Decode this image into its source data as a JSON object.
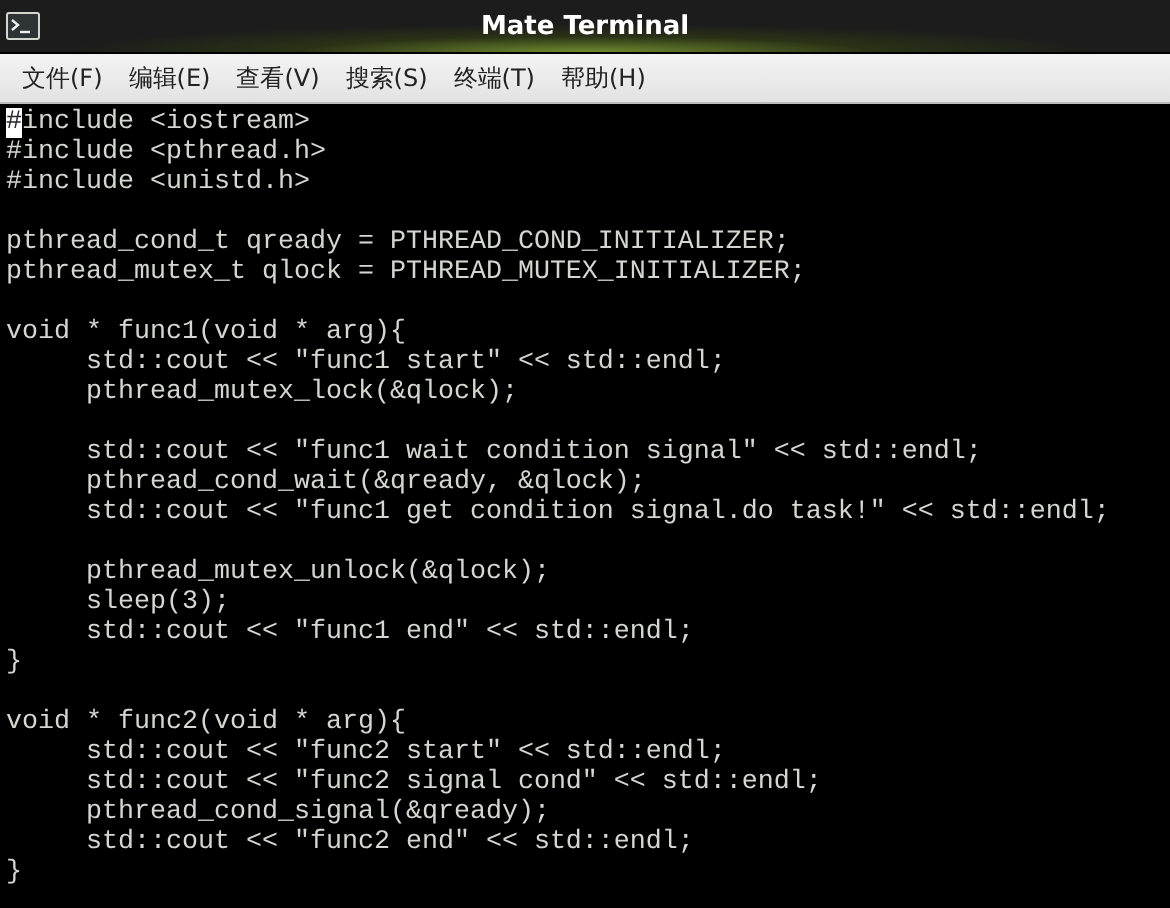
{
  "window": {
    "title": "Mate Terminal"
  },
  "menu": [
    {
      "label": "文件(F)"
    },
    {
      "label": "编辑(E)"
    },
    {
      "label": "查看(V)"
    },
    {
      "label": "搜索(S)"
    },
    {
      "label": "终端(T)"
    },
    {
      "label": "帮助(H)"
    }
  ],
  "terminal": {
    "lines": [
      {
        "kind": "code",
        "text": "#include <iostream>",
        "cursor": true
      },
      {
        "kind": "code",
        "text": "#include <pthread.h>",
        "cursor": false
      },
      {
        "kind": "code",
        "text": "#include <unistd.h>",
        "cursor": false
      },
      {
        "kind": "blank"
      },
      {
        "kind": "code",
        "text": "pthread_cond_t qready = PTHREAD_COND_INITIALIZER;",
        "cursor": false
      },
      {
        "kind": "code",
        "text": "pthread_mutex_t qlock = PTHREAD_MUTEX_INITIALIZER;",
        "cursor": false
      },
      {
        "kind": "blank"
      },
      {
        "kind": "code",
        "text": "void * func1(void * arg){",
        "cursor": false
      },
      {
        "kind": "code",
        "text": "     std::cout << \"func1 start\" << std::endl;",
        "cursor": false
      },
      {
        "kind": "code",
        "text": "     pthread_mutex_lock(&qlock);",
        "cursor": false
      },
      {
        "kind": "blank"
      },
      {
        "kind": "code",
        "text": "     std::cout << \"func1 wait condition signal\" << std::endl;",
        "cursor": false
      },
      {
        "kind": "code",
        "text": "     pthread_cond_wait(&qready, &qlock);",
        "cursor": false
      },
      {
        "kind": "code",
        "text": "     std::cout << \"func1 get condition signal.do task!\" << std::endl;",
        "cursor": false
      },
      {
        "kind": "blank"
      },
      {
        "kind": "code",
        "text": "     pthread_mutex_unlock(&qlock);",
        "cursor": false
      },
      {
        "kind": "code",
        "text": "     sleep(3);",
        "cursor": false
      },
      {
        "kind": "code",
        "text": "     std::cout << \"func1 end\" << std::endl;",
        "cursor": false
      },
      {
        "kind": "code",
        "text": "}",
        "cursor": false
      },
      {
        "kind": "blank"
      },
      {
        "kind": "code",
        "text": "void * func2(void * arg){",
        "cursor": false
      },
      {
        "kind": "code",
        "text": "     std::cout << \"func2 start\" << std::endl;",
        "cursor": false
      },
      {
        "kind": "code",
        "text": "     std::cout << \"func2 signal cond\" << std::endl;",
        "cursor": false
      },
      {
        "kind": "code",
        "text": "     pthread_cond_signal(&qready);",
        "cursor": false
      },
      {
        "kind": "code",
        "text": "     std::cout << \"func2 end\" << std::endl;",
        "cursor": false
      },
      {
        "kind": "code",
        "text": "}",
        "cursor": false
      }
    ]
  }
}
